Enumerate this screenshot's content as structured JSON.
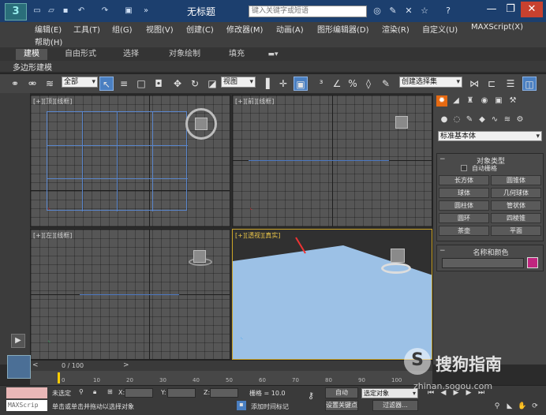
{
  "app": {
    "window_title": "无标题",
    "logo_text": "3",
    "search_placeholder": "键入关键字或短语"
  },
  "quick_access": [
    "new-file-icon",
    "open-file-icon",
    "save-icon",
    "undo-icon",
    "redo-icon",
    "project-folder-icon"
  ],
  "title_icons": [
    "binoculars-icon",
    "tools-icon",
    "exchange-icon",
    "star-icon",
    "help-icon"
  ],
  "window_controls": {
    "minimize": "—",
    "restore": "❐",
    "close": "✕"
  },
  "menu": {
    "items": [
      "编辑(E)",
      "工具(T)",
      "组(G)",
      "视图(V)",
      "创建(C)",
      "修改器(M)",
      "动画(A)",
      "图形编辑器(D)",
      "渲染(R)",
      "自定义(U)",
      "MAXScript(X)"
    ],
    "help": "帮助(H)"
  },
  "ribbon": {
    "tabs": [
      "建模",
      "自由形式",
      "选择",
      "对象绘制",
      "填充"
    ],
    "sub_label": "多边形建模"
  },
  "toolbar": {
    "filter_value": "全部",
    "view_value": "视图",
    "selection_set_placeholder": "创建选择集"
  },
  "viewports": [
    {
      "label": "[+][顶][线框]",
      "view": "top"
    },
    {
      "label": "[+][前][线框]",
      "view": "front"
    },
    {
      "label": "[+][左][线框]",
      "view": "left"
    },
    {
      "label": "[+][透视][真实]",
      "view": "perspective"
    }
  ],
  "command_panel": {
    "category_value": "标准基本体",
    "object_type": {
      "title": "对象类型",
      "autogrid_label": "自动栅格",
      "buttons": [
        "长方体",
        "圆锥体",
        "球体",
        "几何球体",
        "圆柱体",
        "管状体",
        "圆环",
        "四棱锥",
        "茶壶",
        "平面"
      ]
    },
    "name_color": {
      "title": "名称和颜色",
      "swatch_color": "#c0267f"
    }
  },
  "timeline": {
    "frame_counter": "0 / 100",
    "ticks": [
      "0",
      "10",
      "20",
      "30",
      "40",
      "50",
      "60",
      "70",
      "80",
      "90",
      "100"
    ]
  },
  "status": {
    "maxscript_label": "MAXScrip",
    "selection": "未选定",
    "prompt": "单击或单击并拖动以选择对象",
    "x_label": "X:",
    "y_label": "Y:",
    "z_label": "Z:",
    "grid": "栅格 = 10.0",
    "add_time_tag": "添加时间标记",
    "auto_key": "自动",
    "set_key": "设置关键点",
    "key_filter_value": "选定对象",
    "filters": "过滤器..."
  },
  "watermark": {
    "logo": "S",
    "text": "搜狗指南",
    "url": "zhinan.sogou.com"
  }
}
